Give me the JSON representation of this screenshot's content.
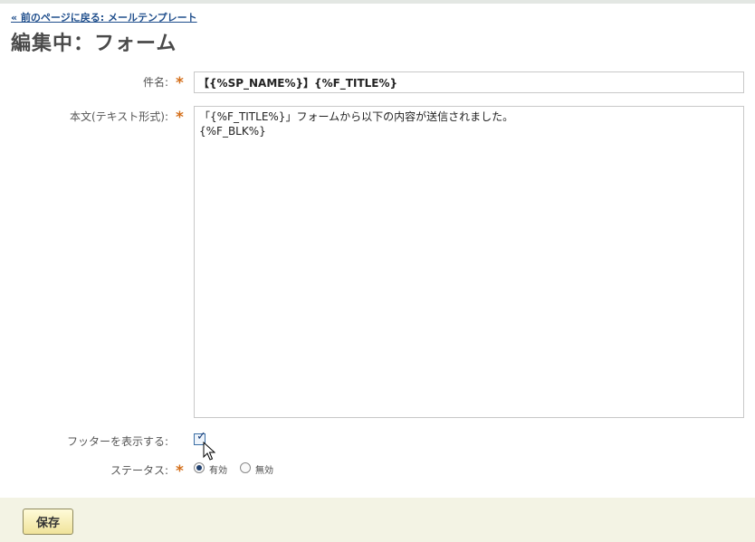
{
  "nav": {
    "back_link": "« 前のページに戻る: メールテンプレート"
  },
  "page": {
    "title": "編集中：フォーム"
  },
  "form": {
    "subject": {
      "label": "件名:",
      "required_mark": "*",
      "value": "【{%SP_NAME%}】{%F_TITLE%}"
    },
    "body": {
      "label": "本文(テキスト形式):",
      "required_mark": "*",
      "value": "「{%F_TITLE%}」フォームから以下の内容が送信されました。\n{%F_BLK%}"
    },
    "footer_toggle": {
      "label": "フッターを表示する:",
      "checked": true,
      "tick": "✓"
    },
    "status": {
      "label": "ステータス:",
      "required_mark": "*",
      "options": [
        {
          "label": "有効",
          "selected": true
        },
        {
          "label": "無効",
          "selected": false
        }
      ]
    }
  },
  "actions": {
    "save_label": "保存"
  },
  "colors": {
    "required": "#d4701c",
    "link": "#1f4e8c",
    "footer_bg": "#f3f3e4"
  }
}
